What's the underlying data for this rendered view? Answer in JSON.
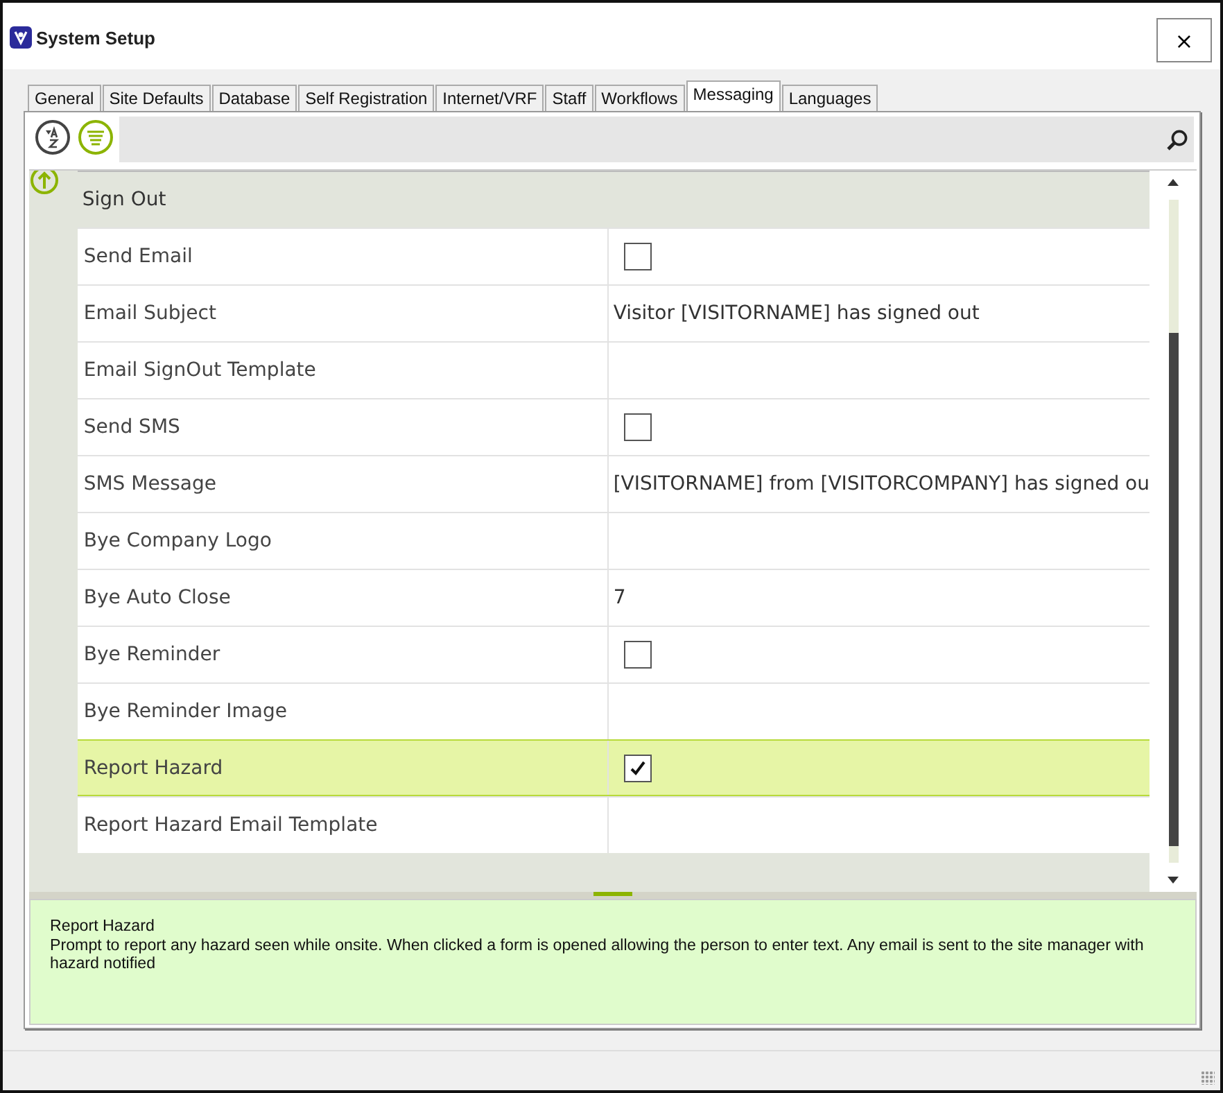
{
  "window": {
    "title": "System Setup",
    "close": "×"
  },
  "tabs": [
    {
      "label": "General",
      "selected": false
    },
    {
      "label": "Site Defaults",
      "selected": false
    },
    {
      "label": "Database",
      "selected": false
    },
    {
      "label": "Self Registration",
      "selected": false
    },
    {
      "label": "Internet/VRF",
      "selected": false
    },
    {
      "label": "Staff",
      "selected": false
    },
    {
      "label": "Workflows",
      "selected": false
    },
    {
      "label": "Messaging",
      "selected": true
    },
    {
      "label": "Languages",
      "selected": false
    }
  ],
  "toolbar": {
    "sort_alpha_selected": false,
    "categorized_selected": true
  },
  "category": {
    "title": "Sign Out",
    "expanded": true
  },
  "rows": [
    {
      "name": "Send Email",
      "kind": "checkbox",
      "checked": false,
      "selected": false
    },
    {
      "name": "Email Subject",
      "kind": "text",
      "value": "Visitor [VISITORNAME] has signed out",
      "selected": false
    },
    {
      "name": "Email SignOut Template",
      "kind": "text",
      "selected": false
    },
    {
      "name": "Send SMS",
      "kind": "checkbox",
      "checked": false,
      "selected": false
    },
    {
      "name": "SMS Message",
      "kind": "text",
      "value": "[VISITORNAME] from [VISITORCOMPANY] has signed ou",
      "selected": false
    },
    {
      "name": "Bye Company Logo",
      "kind": "text",
      "selected": false
    },
    {
      "name": "Bye Auto Close",
      "kind": "text",
      "value": "7",
      "selected": false
    },
    {
      "name": "Bye Reminder",
      "kind": "checkbox",
      "checked": false,
      "selected": false
    },
    {
      "name": "Bye Reminder Image",
      "kind": "text",
      "selected": false
    },
    {
      "name": "Report Hazard",
      "kind": "checkbox",
      "checked": true,
      "selected": true
    },
    {
      "name": "Report Hazard Email Template",
      "kind": "text",
      "selected": false
    }
  ],
  "description": {
    "title": "Report Hazard",
    "text": "Prompt to report any hazard seen while onsite. When clicked a form is opened allowing the person to enter text. Any email is sent to the site manager with hazard notified"
  }
}
